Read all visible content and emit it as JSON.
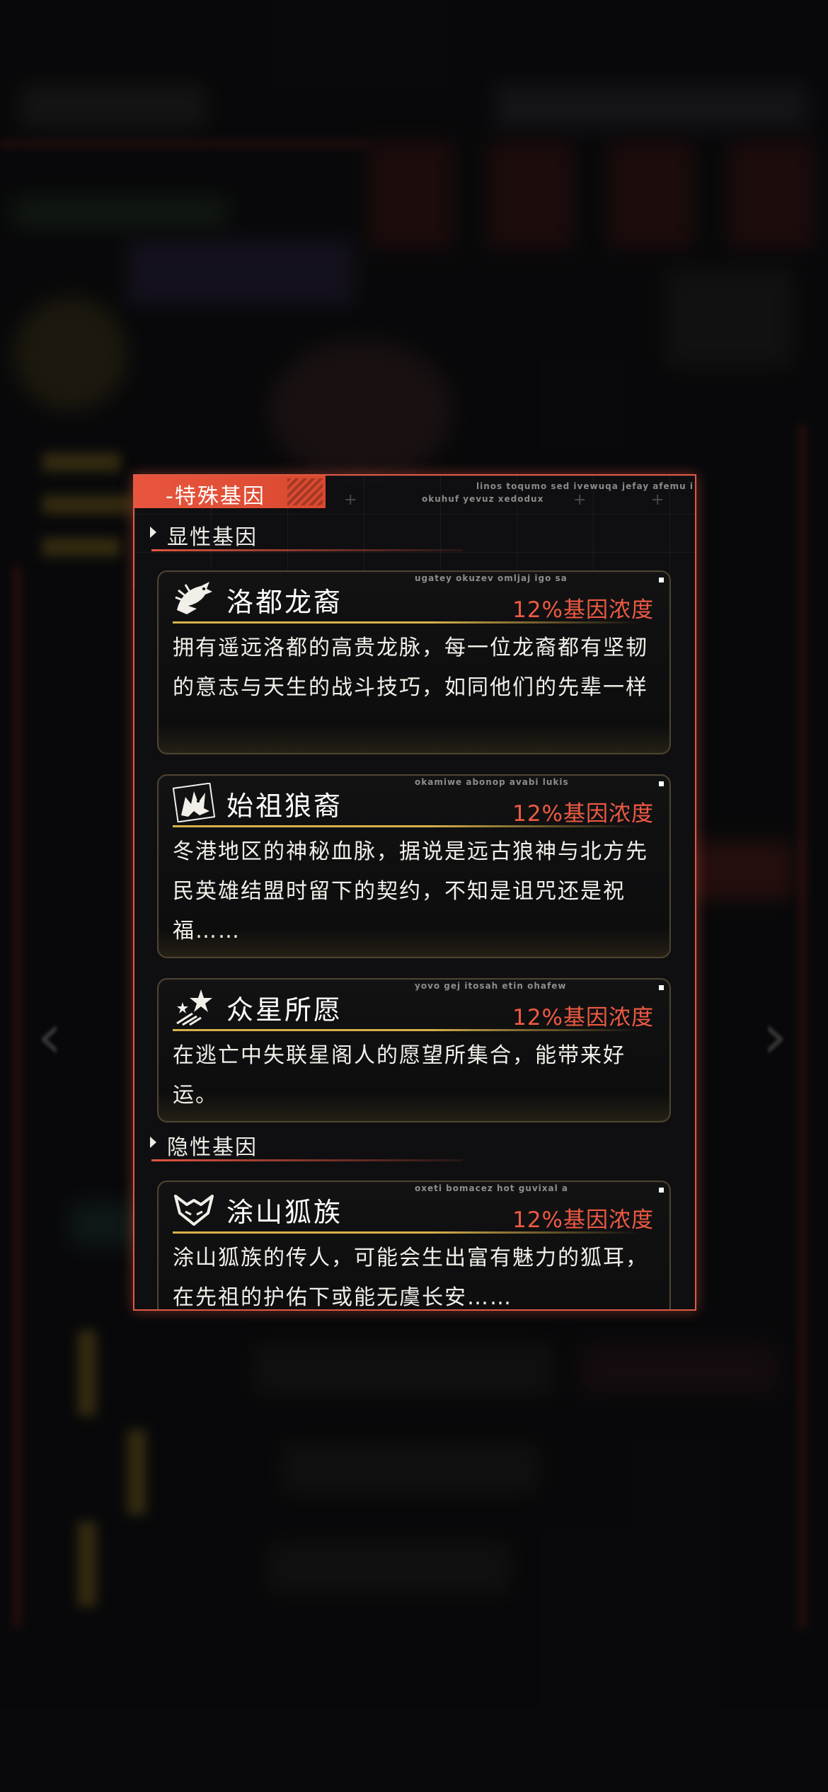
{
  "panel": {
    "title": "-特殊基因",
    "deco_line1": "linos toqumo sed ivewuqa jefay afemu i",
    "deco_line2": "okuhuf yevuz xedodux"
  },
  "sections": {
    "dominant": {
      "label": "显性基因"
    },
    "recessive": {
      "label": "隐性基因"
    }
  },
  "genes": [
    {
      "icon": "dragon-icon",
      "name": "洛都龙裔",
      "concentration": "12%基因浓度",
      "serial": "ugatey okuzev omljaj igo sa",
      "description": "拥有遥远洛都的高贵龙脉，每一位龙裔都有坚韧的意志与天生的战斗技巧，如同他们的先辈一样"
    },
    {
      "icon": "wolf-icon",
      "name": "始祖狼裔",
      "concentration": "12%基因浓度",
      "serial": "okamiwe abonop avabi lukis",
      "description": "冬港地区的神秘血脉，据说是远古狼神与北方先民英雄结盟时留下的契约，不知是诅咒还是祝福……"
    },
    {
      "icon": "stars-icon",
      "name": "众星所愿",
      "concentration": "12%基因浓度",
      "serial": "yovo gej itosah etin ohafew",
      "description": "在逃亡中失联星阁人的愿望所集合，能带来好运。"
    },
    {
      "icon": "fox-icon",
      "name": "涂山狐族",
      "concentration": "12%基因浓度",
      "serial": "oxeti bomacez hot guvixal a",
      "description": "涂山狐族的传人，可能会生出富有魅力的狐耳，在先祖的护佑下或能无虞长安……"
    }
  ]
}
